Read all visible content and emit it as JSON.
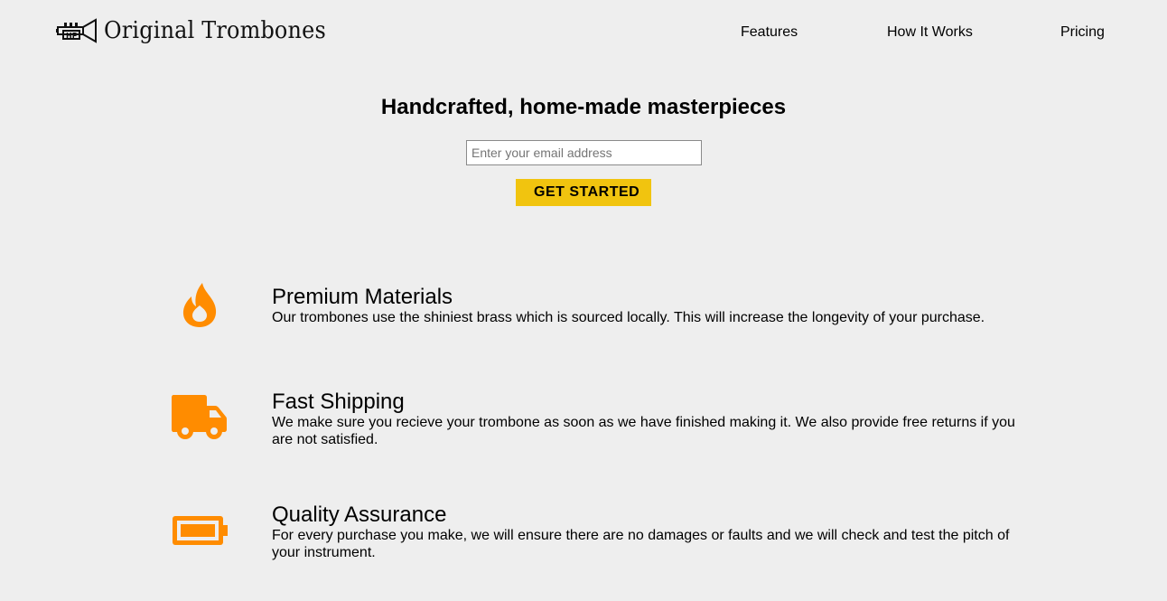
{
  "brand": {
    "name": "Original Trombones",
    "logo_icon": "trumpet-logo-icon"
  },
  "nav": {
    "items": [
      {
        "label": "Features"
      },
      {
        "label": "How It Works"
      },
      {
        "label": "Pricing"
      }
    ]
  },
  "hero": {
    "title": "Handcrafted, home-made masterpieces",
    "email_placeholder": "Enter your email address",
    "cta_label": "GET STARTED",
    "cta_color": "#f1c40f"
  },
  "features": [
    {
      "icon": "fire-icon",
      "title": "Premium Materials",
      "description": "Our trombones use the shiniest brass which is sourced locally. This will increase the longevity of your purchase."
    },
    {
      "icon": "truck-icon",
      "title": "Fast Shipping",
      "description": "We make sure you recieve your trombone as soon as we have finished making it. We also provide free returns if you are not satisfied."
    },
    {
      "icon": "battery-icon",
      "title": "Quality Assurance",
      "description": "For every purchase you make, we will ensure there are no damages or faults and we will check and test the pitch of your instrument."
    }
  ],
  "colors": {
    "accent": "#ff8c00",
    "background": "#eeeeee"
  }
}
